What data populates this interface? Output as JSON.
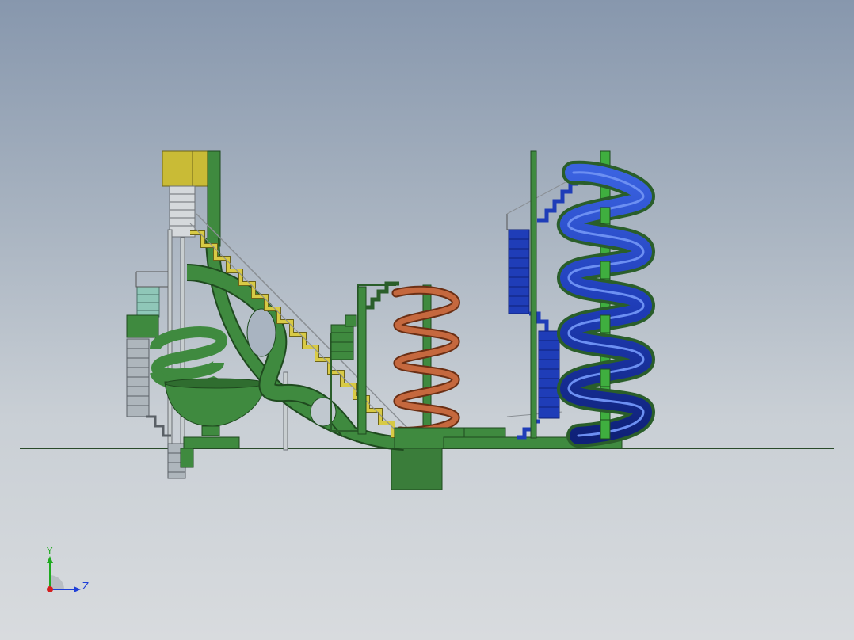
{
  "viewport": {
    "background_top": "#8797ad",
    "background_bottom": "#d8dbde"
  },
  "model": {
    "description_icon": "waterpark-slides-assembly",
    "colors": {
      "slide_green": "#3f8a3f",
      "slide_green_dark": "#2a5e2a",
      "tower_yellow": "#c9bb36",
      "stairs_gray": "#c8ced0",
      "spiral_orange": "#c5683e",
      "spiral_blue": "#1f3db8",
      "teal_stairs": "#8fc7b8"
    }
  },
  "triad": {
    "y_label": "Y",
    "z_label": "Z",
    "y_color": "#1faa1f",
    "z_color": "#1f3fd8",
    "x_color": "#d41f1f"
  }
}
